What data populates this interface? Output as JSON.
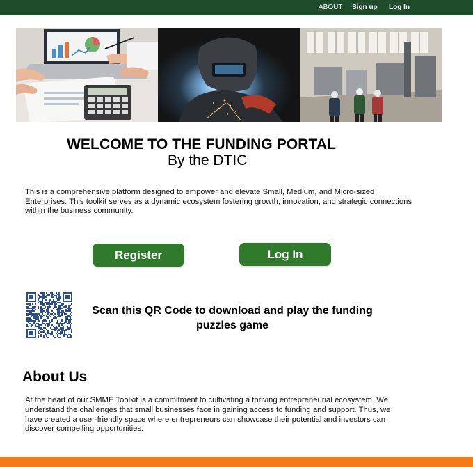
{
  "nav": {
    "about": "ABOUT",
    "signup": "Sign up",
    "login": "Log In"
  },
  "hero": {
    "panels": [
      {
        "icon": "finance-desk-image"
      },
      {
        "icon": "welder-image"
      },
      {
        "icon": "factory-floor-image"
      }
    ]
  },
  "welcome": {
    "title": "WELCOME TO THE FUNDING PORTAL",
    "subtitle": "By the DTIC"
  },
  "intro": {
    "text": "This is a comprehensive platform designed to empower and elevate Small, Medium, and Micro-sized Enterprises. This toolkit serves as a dynamic ecosystem fostering growth, innovation, and strategic connections within the business community."
  },
  "actions": {
    "register": "Register",
    "login": "Log In"
  },
  "qr": {
    "icon": "qr-code-icon",
    "text": "Scan this QR Code to download and play the funding puzzles game"
  },
  "about": {
    "heading": "About Us",
    "text": "At the heart of our SMME Toolkit is a commitment to cultivating a thriving entrepreneurial ecosystem. We understand the challenges that small businesses face in gaining access to funding and support. Thus, we have created a user-friendly space where entrepreneurs can showcase their potential and investors can discover compelling opportunities."
  },
  "colors": {
    "topbar": "#1f4d2b",
    "button": "#2f7a2b",
    "footer": "#f47b16"
  }
}
